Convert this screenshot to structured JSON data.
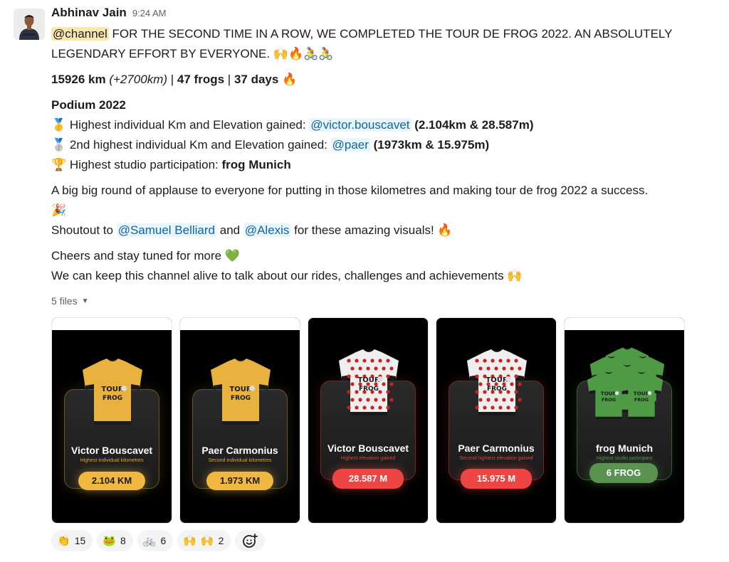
{
  "message": {
    "sender": "Abhinav Jain",
    "timestamp": "9:24 AM",
    "channel_mention": "@channel",
    "headline_line1": " FOR THE SECOND TIME IN A ROW, WE COMPLETED THE TOUR DE FROG 2022. AN ABSOLUTELY",
    "headline_line2": "LEGENDARY EFFORT BY EVERYONE. ",
    "headline_emojis": [
      "raising-hands-medium-skin",
      "fire",
      "cyclist",
      "cyclist-woman"
    ],
    "stats": {
      "km": "15926 km",
      "delta": "(+2700km)",
      "sep1": " | ",
      "frogs": "47 frogs",
      "sep2": " | ",
      "days": "37 days",
      "emoji": "fire"
    },
    "podium": {
      "title": "Podium 2022",
      "items": [
        {
          "icon": "gold-medal",
          "label": "Highest individual Km and Elevation gained: ",
          "mention": "@victor.bouscavet",
          "detail": " (2.104km & 28.587m)"
        },
        {
          "icon": "silver-medal",
          "label": "2nd highest individual Km and Elevation gained: ",
          "mention": "@paer",
          "detail": " (1973km & 15.975m)"
        },
        {
          "icon": "trophy",
          "label": "Highest studio participation: ",
          "mention": "",
          "detail": "frog Munich"
        }
      ]
    },
    "applause": "A big big round of applause to everyone for putting in those kilometres and making tour de frog 2022 a success.",
    "applause_emoji": "party-popper",
    "shoutout": {
      "prefix": "Shoutout to ",
      "mention1": "@Samuel Belliard",
      "middle": " and ",
      "mention2": "@Alexis",
      "suffix": " for these amazing visuals! ",
      "emoji": "fire"
    },
    "cheers": "Cheers and stay tuned for more ",
    "cheers_emoji": "green-heart",
    "keep_alive": "We can keep this channel alive to talk about our rides, challenges and achievements ",
    "keep_alive_emoji": "raising-hands-medium-skin"
  },
  "files": {
    "toggle_label": "5 files",
    "items": [
      {
        "theme": "yellow",
        "name": "Victor Bouscavet",
        "subtitle": "Highest individual kilometres",
        "value": "2.104 KM",
        "jersey_color": "#e9b13e"
      },
      {
        "theme": "yellow",
        "name": "Paer Carmonius",
        "subtitle": "Second individual kilometres",
        "value": "1.973 KM",
        "jersey_color": "#e9b13e"
      },
      {
        "theme": "red",
        "name": "Victor Bouscavet",
        "subtitle": "Highest elevation gained",
        "value": "28.587 M",
        "jersey_color": "#eeeeee"
      },
      {
        "theme": "red",
        "name": "Paer Carmonius",
        "subtitle": "Second hightest elevation gained",
        "value": "15.975 M",
        "jersey_color": "#eeeeee"
      },
      {
        "theme": "green",
        "name": "frog Munich",
        "subtitle": "Highest studio participant",
        "value": "6 FROG",
        "jersey_color": "#4f9a45"
      }
    ]
  },
  "reactions": [
    {
      "emoji": "clapping-hands",
      "count": "15"
    },
    {
      "emoji": "frog",
      "count": "8"
    },
    {
      "emoji": "bicycle",
      "count": "6"
    },
    {
      "emoji": "raising-hands-pair",
      "count": "2"
    }
  ],
  "add_reaction_icon": "add-reaction-icon"
}
